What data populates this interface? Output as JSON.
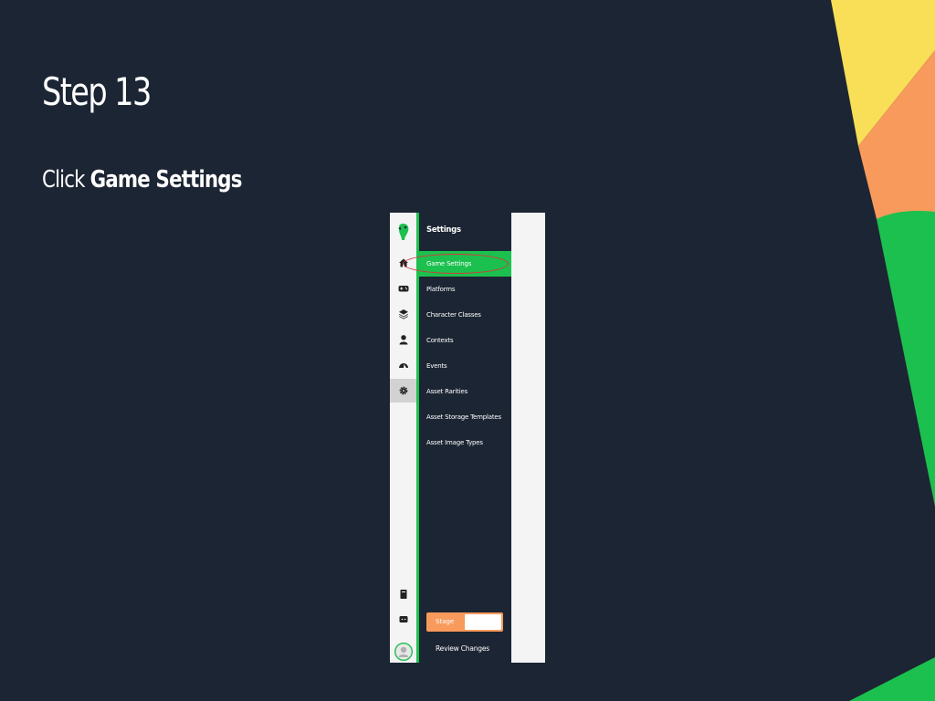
{
  "slide": {
    "title": "Step 13",
    "instruction_prefix": "Click ",
    "instruction_target": "Game Settings"
  },
  "colors": {
    "background": "#1c2533",
    "accent_green": "#1cc04e",
    "accent_orange": "#f89a5c",
    "accent_yellow": "#f9df57",
    "highlight_red": "#d9363a"
  },
  "app": {
    "rail_icons": [
      "parrot-logo-icon",
      "home-icon",
      "gamepad-icon",
      "layers-icon",
      "user-icon",
      "dashboard-icon",
      "gear-icon",
      "book-icon",
      "chat-icon",
      "avatar-icon"
    ],
    "menu": {
      "header": "Settings",
      "items": [
        {
          "label": "Game Settings",
          "active": true
        },
        {
          "label": "Platforms"
        },
        {
          "label": "Character Classes"
        },
        {
          "label": "Contexts"
        },
        {
          "label": "Events"
        },
        {
          "label": "Asset Rarities"
        },
        {
          "label": "Asset Storage Templates"
        },
        {
          "label": "Asset Image Types"
        }
      ],
      "stage_label": "Stage",
      "review_label": "Review Changes"
    }
  }
}
